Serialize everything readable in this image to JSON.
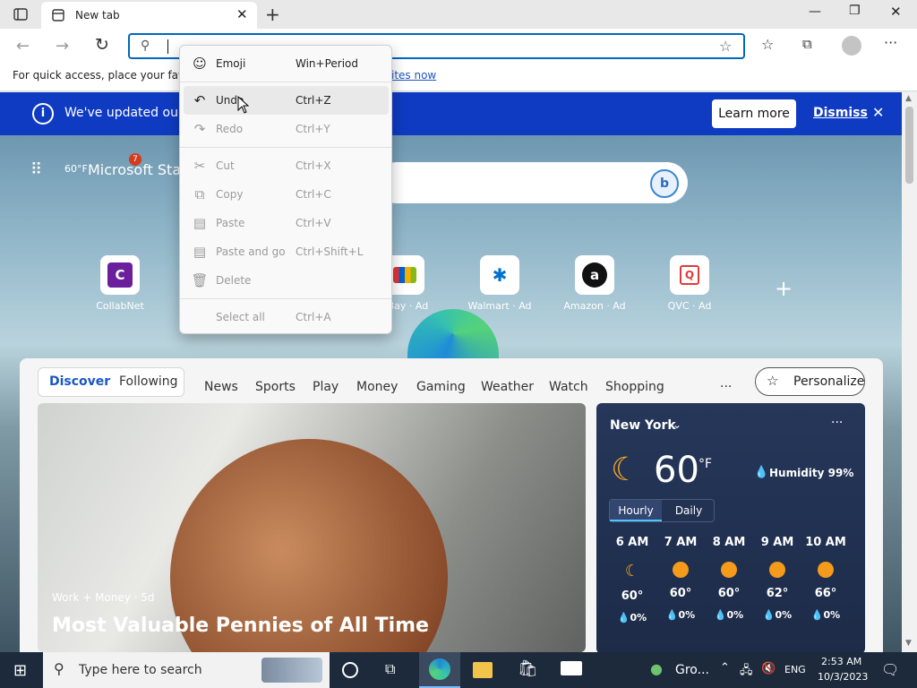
{
  "browser": {
    "tab_title": "New tab",
    "address_value": "",
    "favorites_prompt": "For quick access, place your favori",
    "favorites_link": "ites now"
  },
  "banner": {
    "text": "We've updated our T",
    "learn_more": "Learn more",
    "dismiss": "Dismiss"
  },
  "context_menu": {
    "items": [
      {
        "label": "Emoji",
        "shortcut": "Win+Period",
        "enabled": true
      },
      {
        "label": "Undo",
        "shortcut": "Ctrl+Z",
        "enabled": true
      },
      {
        "label": "Redo",
        "shortcut": "Ctrl+Y",
        "enabled": false
      },
      {
        "label": "Cut",
        "shortcut": "Ctrl+X",
        "enabled": false
      },
      {
        "label": "Copy",
        "shortcut": "Ctrl+C",
        "enabled": false
      },
      {
        "label": "Paste",
        "shortcut": "Ctrl+V",
        "enabled": false
      },
      {
        "label": "Paste and go",
        "shortcut": "Ctrl+Shift+L",
        "enabled": false
      },
      {
        "label": "Delete",
        "shortcut": "",
        "enabled": false
      },
      {
        "label": "Select all",
        "shortcut": "Ctrl+A",
        "enabled": false
      }
    ]
  },
  "start_page": {
    "brand": "Microsoft Star",
    "temp_badge": "60°F",
    "notification_count": "7",
    "quick_links": [
      {
        "label": "CollabNet",
        "letter": "C"
      },
      {
        "label": "eBay · Ad",
        "letter": ""
      },
      {
        "label": "Walmart · Ad",
        "letter": "✱"
      },
      {
        "label": "Amazon · Ad",
        "letter": "a"
      },
      {
        "label": "QVC · Ad",
        "letter": "Q"
      }
    ]
  },
  "feed": {
    "tabs": [
      "Discover",
      "Following"
    ],
    "nav": [
      "News",
      "Sports",
      "Play",
      "Money",
      "Gaming",
      "Weather",
      "Watch",
      "Shopping"
    ],
    "more": "···",
    "personalize": "Personalize",
    "article": {
      "source": "Work + Money · 5d",
      "title": "Most Valuable Pennies of All Time"
    }
  },
  "weather": {
    "city": "New York",
    "temp": "60",
    "unit": "°F",
    "humidity": "Humidity 99%",
    "tabs": [
      "Hourly",
      "Daily"
    ],
    "hours": [
      {
        "time": "6 AM",
        "temp": "60°",
        "precip": "0%",
        "icon": "moon"
      },
      {
        "time": "7 AM",
        "temp": "60°",
        "precip": "0%",
        "icon": "sun"
      },
      {
        "time": "8 AM",
        "temp": "60°",
        "precip": "0%",
        "icon": "sun"
      },
      {
        "time": "9 AM",
        "temp": "62°",
        "precip": "0%",
        "icon": "sun"
      },
      {
        "time": "10 AM",
        "temp": "66°",
        "precip": "0%",
        "icon": "sun"
      }
    ]
  },
  "taskbar": {
    "search_placeholder": "Type here to search",
    "tray_app": "Gro...",
    "language": "ENG",
    "time": "2:53 AM",
    "date": "10/3/2023"
  }
}
